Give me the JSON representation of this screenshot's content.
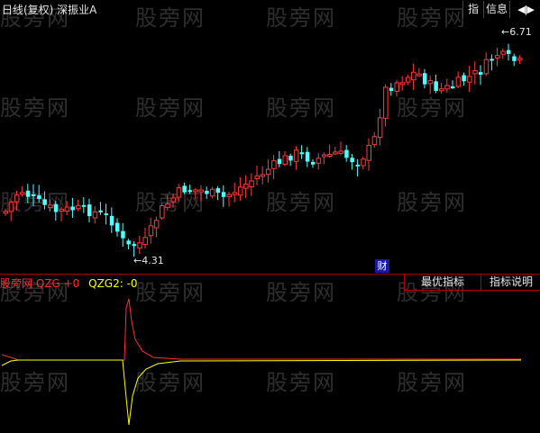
{
  "header": {
    "title": "日线(复权) 深振业A",
    "buttons": {
      "indicator": "指",
      "info": "信息",
      "arrows": "◀|▶"
    }
  },
  "watermark": "股旁网",
  "price_chart": {
    "high_label": "6.71",
    "low_label": "4.31",
    "fin_badge": "财",
    "colors": {
      "up": "#ff3c3c",
      "down": "#54ffff",
      "arrow": "#e6e6e6"
    }
  },
  "indicator": {
    "name": "股旁网 QZG",
    "v1": "+0",
    "v2_label": "QZG2: -0",
    "tabs": {
      "best": "最优指标",
      "desc": "指标说明"
    },
    "colors": {
      "line1": "#ff3030",
      "line2": "#ffff00"
    }
  }
}
